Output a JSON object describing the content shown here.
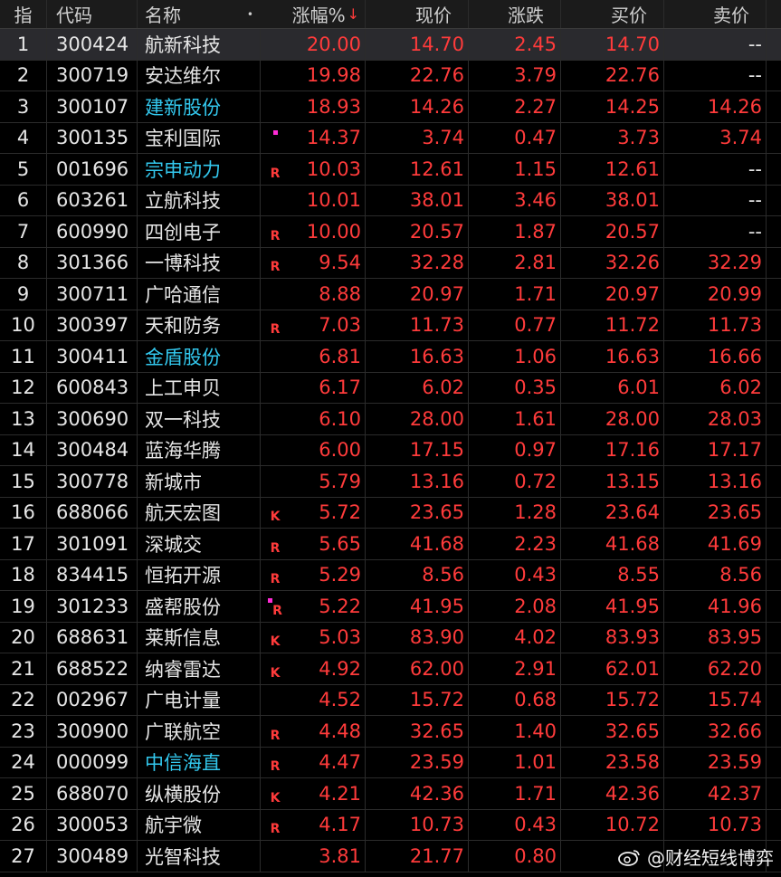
{
  "header": {
    "idx": "指",
    "code": "代码",
    "name": "名称",
    "name_dot": "•",
    "pct": "涨幅%",
    "pct_sort": "↓",
    "price": "现价",
    "change": "涨跌",
    "bid": "买价",
    "ask": "卖价"
  },
  "colors": {
    "up": "#ff3b3b",
    "name_default": "#e6e6e6",
    "name_highlight": "#33c8ee",
    "marker_dot": "#ff2bd6"
  },
  "rows": [
    {
      "idx": "1",
      "code": "300424",
      "name": "航新科技",
      "name_color": "white",
      "dot": false,
      "flag": "",
      "pct": "20.00",
      "price": "14.70",
      "change": "2.45",
      "bid": "14.70",
      "ask": "--",
      "selected": true
    },
    {
      "idx": "2",
      "code": "300719",
      "name": "安达维尔",
      "name_color": "white",
      "dot": false,
      "flag": "",
      "pct": "19.98",
      "price": "22.76",
      "change": "3.79",
      "bid": "22.76",
      "ask": "--"
    },
    {
      "idx": "3",
      "code": "300107",
      "name": "建新股份",
      "name_color": "cyan",
      "dot": false,
      "flag": "",
      "pct": "18.93",
      "price": "14.26",
      "change": "2.27",
      "bid": "14.25",
      "ask": "14.26"
    },
    {
      "idx": "4",
      "code": "300135",
      "name": "宝利国际",
      "name_color": "white",
      "dot": true,
      "flag": "",
      "pct": "14.37",
      "price": "3.74",
      "change": "0.47",
      "bid": "3.73",
      "ask": "3.74"
    },
    {
      "idx": "5",
      "code": "001696",
      "name": "宗申动力",
      "name_color": "cyan",
      "dot": false,
      "flag": "R",
      "pct": "10.03",
      "price": "12.61",
      "change": "1.15",
      "bid": "12.61",
      "ask": "--"
    },
    {
      "idx": "6",
      "code": "603261",
      "name": "立航科技",
      "name_color": "white",
      "dot": false,
      "flag": "",
      "pct": "10.01",
      "price": "38.01",
      "change": "3.46",
      "bid": "38.01",
      "ask": "--"
    },
    {
      "idx": "7",
      "code": "600990",
      "name": "四创电子",
      "name_color": "white",
      "dot": false,
      "flag": "R",
      "pct": "10.00",
      "price": "20.57",
      "change": "1.87",
      "bid": "20.57",
      "ask": "--"
    },
    {
      "idx": "8",
      "code": "301366",
      "name": "一博科技",
      "name_color": "white",
      "dot": false,
      "flag": "R",
      "pct": "9.54",
      "price": "32.28",
      "change": "2.81",
      "bid": "32.26",
      "ask": "32.29"
    },
    {
      "idx": "9",
      "code": "300711",
      "name": "广哈通信",
      "name_color": "white",
      "dot": false,
      "flag": "",
      "pct": "8.88",
      "price": "20.97",
      "change": "1.71",
      "bid": "20.97",
      "ask": "20.99"
    },
    {
      "idx": "10",
      "code": "300397",
      "name": "天和防务",
      "name_color": "white",
      "dot": false,
      "flag": "R",
      "pct": "7.03",
      "price": "11.73",
      "change": "0.77",
      "bid": "11.72",
      "ask": "11.73"
    },
    {
      "idx": "11",
      "code": "300411",
      "name": "金盾股份",
      "name_color": "cyan",
      "dot": false,
      "flag": "",
      "pct": "6.81",
      "price": "16.63",
      "change": "1.06",
      "bid": "16.63",
      "ask": "16.66"
    },
    {
      "idx": "12",
      "code": "600843",
      "name": "上工申贝",
      "name_color": "white",
      "dot": false,
      "flag": "",
      "pct": "6.17",
      "price": "6.02",
      "change": "0.35",
      "bid": "6.01",
      "ask": "6.02"
    },
    {
      "idx": "13",
      "code": "300690",
      "name": "双一科技",
      "name_color": "white",
      "dot": false,
      "flag": "",
      "pct": "6.10",
      "price": "28.00",
      "change": "1.61",
      "bid": "28.00",
      "ask": "28.03"
    },
    {
      "idx": "14",
      "code": "300484",
      "name": "蓝海华腾",
      "name_color": "white",
      "dot": false,
      "flag": "",
      "pct": "6.00",
      "price": "17.15",
      "change": "0.97",
      "bid": "17.16",
      "ask": "17.17"
    },
    {
      "idx": "15",
      "code": "300778",
      "name": "新城市",
      "name_color": "white",
      "dot": false,
      "flag": "",
      "pct": "5.79",
      "price": "13.16",
      "change": "0.72",
      "bid": "13.15",
      "ask": "13.16"
    },
    {
      "idx": "16",
      "code": "688066",
      "name": "航天宏图",
      "name_color": "white",
      "dot": false,
      "flag": "K",
      "pct": "5.72",
      "price": "23.65",
      "change": "1.28",
      "bid": "23.64",
      "ask": "23.65"
    },
    {
      "idx": "17",
      "code": "301091",
      "name": "深城交",
      "name_color": "white",
      "dot": false,
      "flag": "R",
      "pct": "5.65",
      "price": "41.68",
      "change": "2.23",
      "bid": "41.68",
      "ask": "41.69"
    },
    {
      "idx": "18",
      "code": "834415",
      "name": "恒拓开源",
      "name_color": "white",
      "dot": false,
      "flag": "R",
      "pct": "5.29",
      "price": "8.56",
      "change": "0.43",
      "bid": "8.55",
      "ask": "8.56"
    },
    {
      "idx": "19",
      "code": "301233",
      "name": "盛帮股份",
      "name_color": "white",
      "dot": true,
      "flag": "R",
      "pct": "5.22",
      "price": "41.95",
      "change": "2.08",
      "bid": "41.95",
      "ask": "41.96"
    },
    {
      "idx": "20",
      "code": "688631",
      "name": "莱斯信息",
      "name_color": "white",
      "dot": false,
      "flag": "K",
      "pct": "5.03",
      "price": "83.90",
      "change": "4.02",
      "bid": "83.93",
      "ask": "83.95"
    },
    {
      "idx": "21",
      "code": "688522",
      "name": "纳睿雷达",
      "name_color": "white",
      "dot": false,
      "flag": "K",
      "pct": "4.92",
      "price": "62.00",
      "change": "2.91",
      "bid": "62.01",
      "ask": "62.20"
    },
    {
      "idx": "22",
      "code": "002967",
      "name": "广电计量",
      "name_color": "white",
      "dot": false,
      "flag": "",
      "pct": "4.52",
      "price": "15.72",
      "change": "0.68",
      "bid": "15.72",
      "ask": "15.74"
    },
    {
      "idx": "23",
      "code": "300900",
      "name": "广联航空",
      "name_color": "white",
      "dot": false,
      "flag": "R",
      "pct": "4.48",
      "price": "32.65",
      "change": "1.40",
      "bid": "32.65",
      "ask": "32.66"
    },
    {
      "idx": "24",
      "code": "000099",
      "name": "中信海直",
      "name_color": "cyan",
      "dot": false,
      "flag": "R",
      "pct": "4.47",
      "price": "23.59",
      "change": "1.01",
      "bid": "23.58",
      "ask": "23.59"
    },
    {
      "idx": "25",
      "code": "688070",
      "name": "纵横股份",
      "name_color": "white",
      "dot": false,
      "flag": "K",
      "pct": "4.21",
      "price": "42.36",
      "change": "1.71",
      "bid": "42.36",
      "ask": "42.37"
    },
    {
      "idx": "26",
      "code": "300053",
      "name": "航宇微",
      "name_color": "white",
      "dot": false,
      "flag": "R",
      "pct": "4.17",
      "price": "10.73",
      "change": "0.43",
      "bid": "10.72",
      "ask": "10.73"
    },
    {
      "idx": "27",
      "code": "300489",
      "name": "光智科技",
      "name_color": "white",
      "dot": false,
      "flag": "",
      "pct": "3.81",
      "price": "21.77",
      "change": "0.80",
      "bid": "",
      "ask": ""
    }
  ],
  "watermark": {
    "icon": "weibo-icon",
    "text": "@财经短线博弈"
  }
}
